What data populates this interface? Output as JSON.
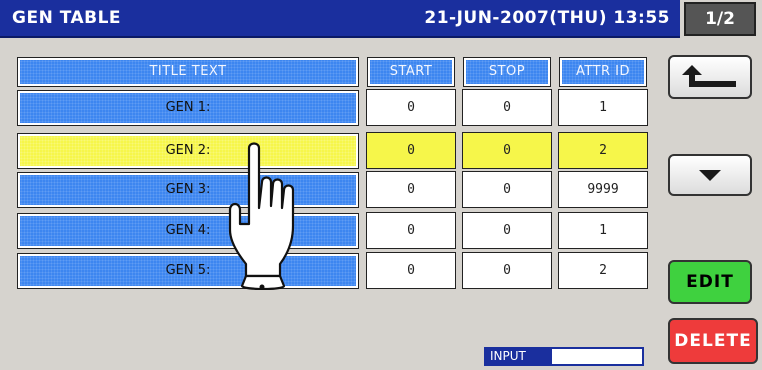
{
  "header": {
    "title": "GEN TABLE",
    "datetime": "21-JUN-2007(THU) 13:55",
    "page": "1/2"
  },
  "table": {
    "columns": [
      "TITLE TEXT",
      "START",
      "STOP",
      "ATTR ID"
    ],
    "rows": [
      {
        "label": "GEN 1:",
        "start": "0",
        "stop": "0",
        "attr": "1"
      },
      {
        "label": "GEN 2:",
        "start": "0",
        "stop": "0",
        "attr": "2"
      },
      {
        "label": "GEN 3:",
        "start": "0",
        "stop": "0",
        "attr": "9999"
      },
      {
        "label": "GEN 4:",
        "start": "0",
        "stop": "0",
        "attr": "1"
      },
      {
        "label": "GEN 5:",
        "start": "0",
        "stop": "0",
        "attr": "2"
      }
    ],
    "selected_row": 1
  },
  "buttons": {
    "back_icon": "return-arrow-icon",
    "down_icon": "triangle-down-icon",
    "edit": "EDIT",
    "delete": "DELETE"
  },
  "input": {
    "label": "INPUT",
    "value": ""
  },
  "colors": {
    "header_bg": "#1a2f9e",
    "row_blue": "#3d86f0",
    "row_selected": "#f6f64a",
    "edit_green": "#3fd13f",
    "delete_red": "#ee3b3b"
  }
}
